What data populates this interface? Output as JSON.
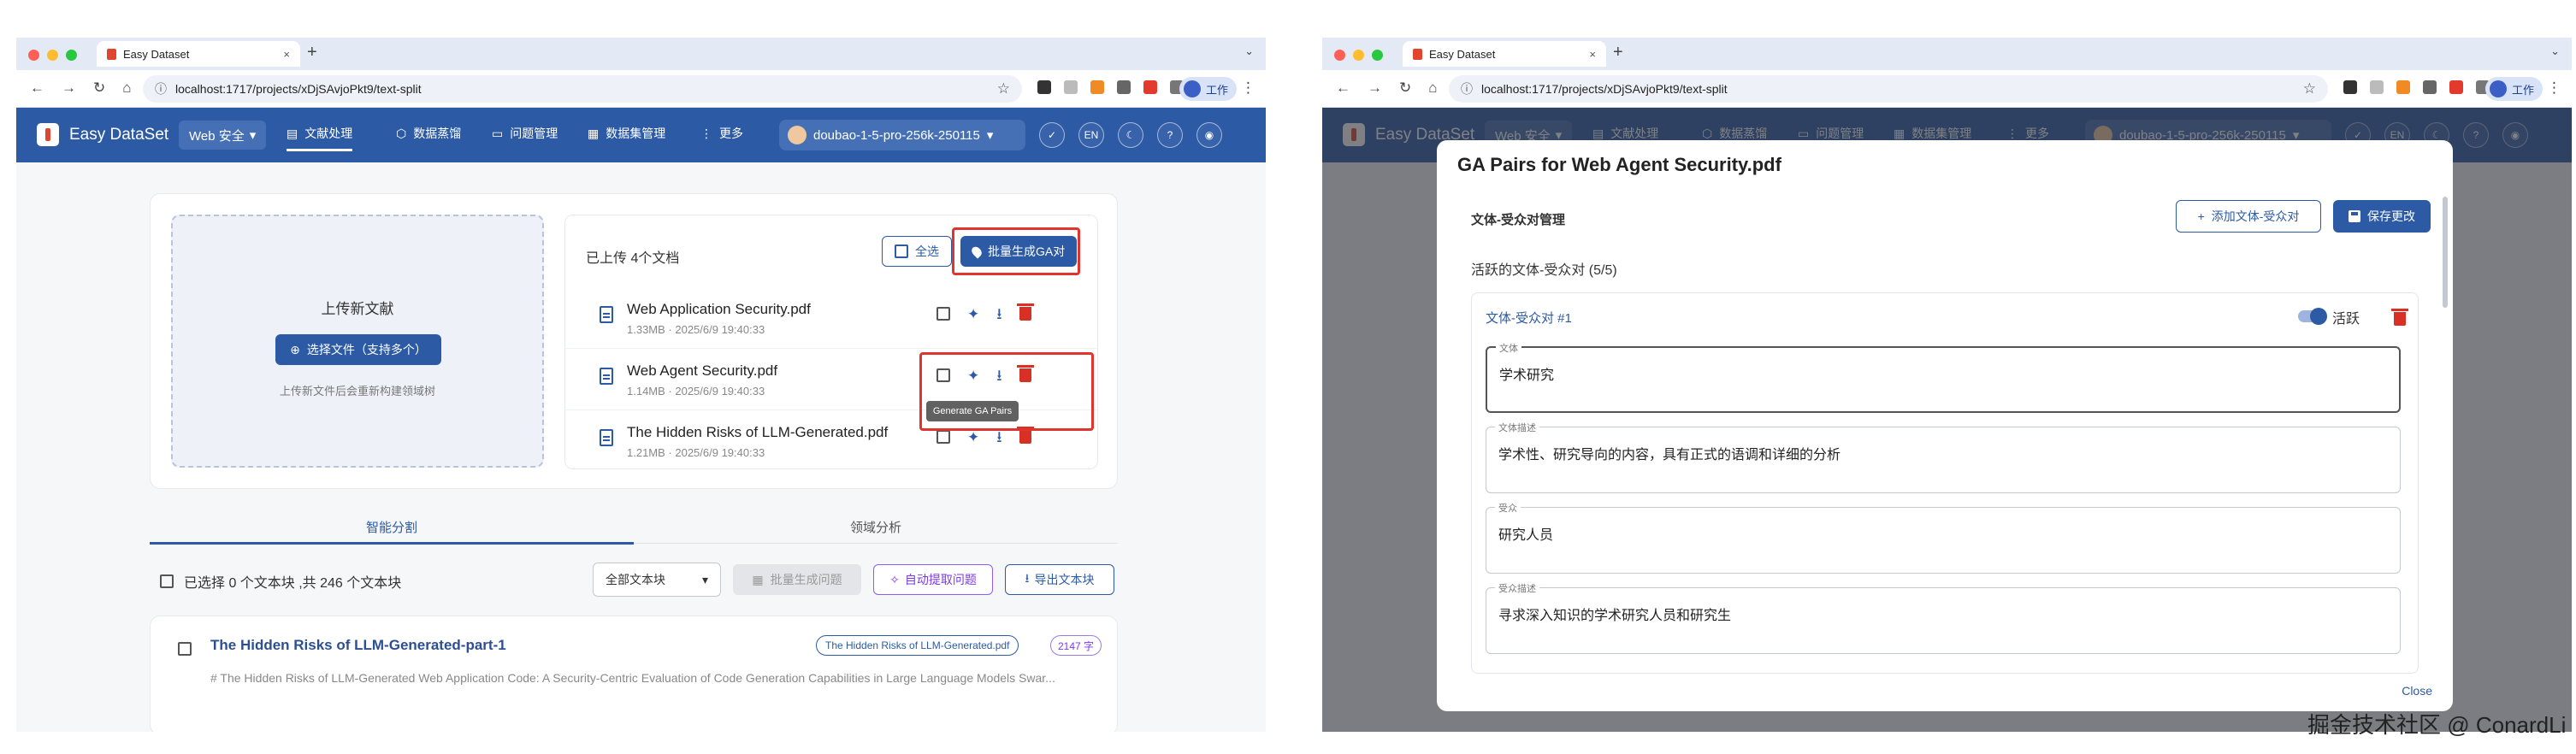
{
  "browser": {
    "tab_title": "Easy Dataset",
    "tab_close": "×",
    "new_tab": "+",
    "tabs_menu": "⌄",
    "url": "localhost:1717/projects/xDjSAvjoPkt9/text-split",
    "profile_label": "工作",
    "nav_back": "←",
    "nav_forward": "→",
    "nav_reload": "↻",
    "nav_home": "⌂",
    "star": "☆",
    "kebab": "⋮",
    "omni_info": "ⓘ"
  },
  "appbar": {
    "brand": "Easy DataSet",
    "project": "Web 安全",
    "project_caret": "▾",
    "nav": [
      {
        "label": "文献处理",
        "icon": "document-icon",
        "glyph": "▤"
      },
      {
        "label": "数据蒸馏",
        "icon": "cube-icon",
        "glyph": "⬡"
      },
      {
        "label": "问题管理",
        "icon": "chat-icon",
        "glyph": "▭"
      },
      {
        "label": "数据集管理",
        "icon": "grid-icon",
        "glyph": "▦"
      },
      {
        "label": "更多",
        "icon": "more-icon",
        "glyph": "⋮"
      }
    ],
    "model": "doubao-1-5-pro-256k-250115",
    "model_caret": "▾",
    "lang": "EN",
    "icons": {
      "check": "✓",
      "moon": "☾",
      "help": "?",
      "github": "◉"
    }
  },
  "upload": {
    "title": "上传新文献",
    "choose_button": "选择文件（支持多个）",
    "hint": "上传新文件后会重新构建领域树",
    "uploaded_count": "已上传 4个文档",
    "select_all": "全选",
    "batch_ga": "批量生成GA对",
    "files": [
      {
        "name": "Web Application Security.pdf",
        "meta": "1.33MB · 2025/6/9 19:40:33"
      },
      {
        "name": "Web Agent Security.pdf",
        "meta": "1.14MB · 2025/6/9 19:40:33"
      },
      {
        "name": "The Hidden Risks of LLM-Generated.pdf",
        "meta": "1.21MB · 2025/6/9 19:40:33"
      }
    ],
    "tooltip": "Generate GA Pairs"
  },
  "tabs": {
    "smart_split": "智能分割",
    "domain_analysis": "领域分析"
  },
  "chunks": {
    "selection": "已选择 0 个文本块 ,共 246 个文本块",
    "filter_value": "全部文本块",
    "filter_caret": "▾",
    "batch_questions": "批量生成问题",
    "auto_extract": "自动提取问题",
    "export": "导出文本块",
    "first": {
      "title": "The Hidden Risks of LLM-Generated-part-1",
      "source": "The Hidden Risks of LLM-Generated.pdf",
      "chars": "2147 字",
      "preview": "# The Hidden Risks of LLM-Generated Web Application Code: A Security-Centric Evaluation of Code Generation Capabilities in Large Language Models Swar..."
    }
  },
  "dialog": {
    "title": "GA Pairs for Web Agent Security.pdf",
    "manage": "文体-受众对管理",
    "add_pair": "添加文体-受众对",
    "save": "保存更改",
    "active_count": "活跃的文体-受众对 (5/5)",
    "pair_title": "文体-受众对 #1",
    "active_label": "活跃",
    "fields": [
      {
        "label": "文体",
        "value": "学术研究"
      },
      {
        "label": "文体描述",
        "value": "学术性、研究导向的内容，具有正式的语调和详细的分析"
      },
      {
        "label": "受众",
        "value": "研究人员"
      },
      {
        "label": "受众描述",
        "value": "寻求深入知识的学术研究人员和研究生"
      }
    ],
    "close": "Close"
  },
  "watermark": "掘金技术社区 @ ConardLi",
  "colors": {
    "primary": "#2c5aa5",
    "danger": "#d93025",
    "highlight": "#e0342e",
    "purple": "#7c3aed"
  }
}
